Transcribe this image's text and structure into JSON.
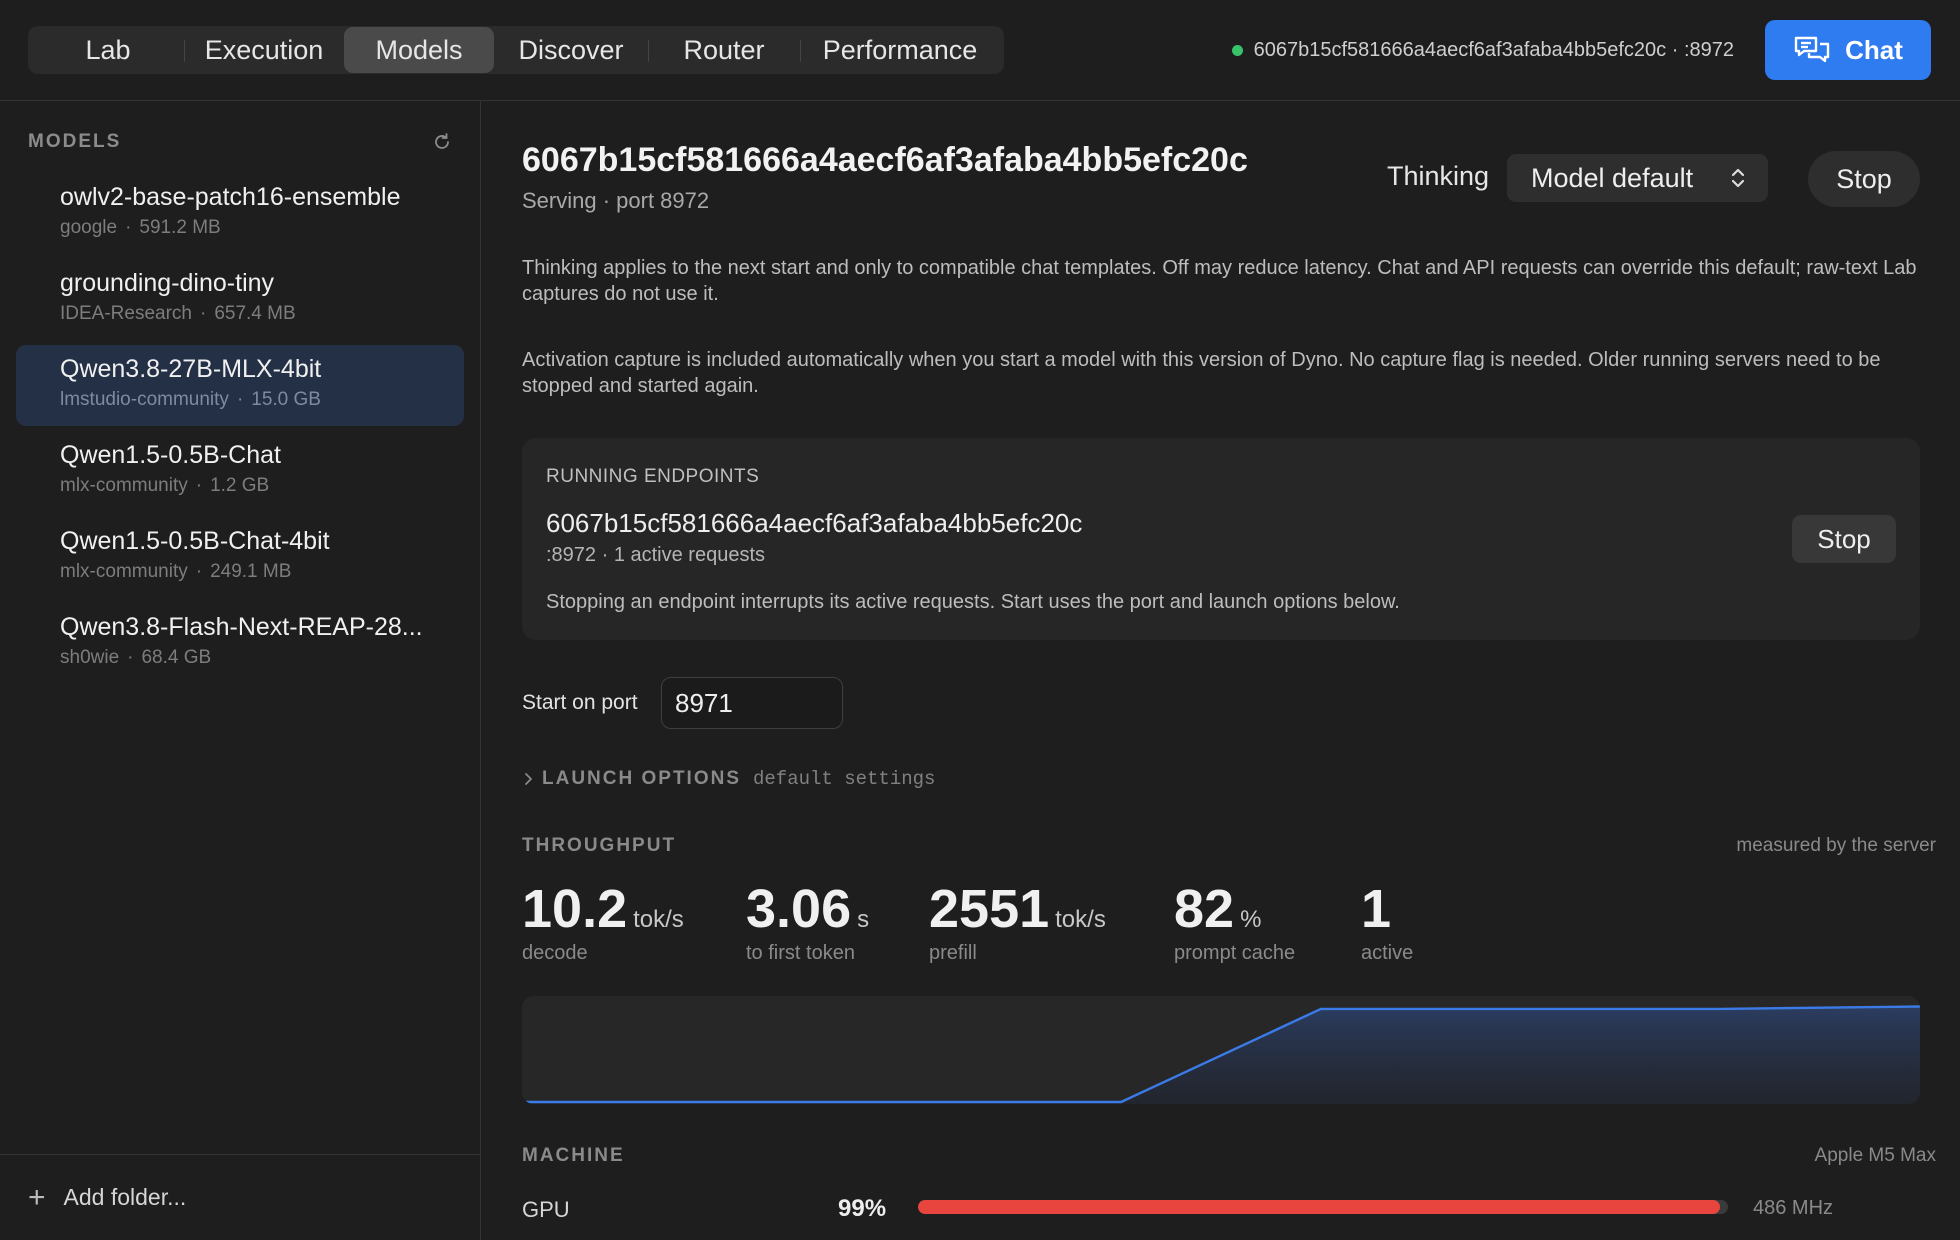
{
  "tabs": [
    {
      "label": "Lab",
      "active": false
    },
    {
      "label": "Execution",
      "active": false
    },
    {
      "label": "Models",
      "active": true
    },
    {
      "label": "Discover",
      "active": false
    },
    {
      "label": "Router",
      "active": false
    },
    {
      "label": "Performance",
      "active": false
    }
  ],
  "header": {
    "endpoint_status": "6067b15cf581666a4aecf6af3afaba4bb5efc20c · :8972",
    "chat_label": "Chat"
  },
  "sidebar": {
    "title": "MODELS",
    "models": [
      {
        "name": "owlv2-base-patch16-ensemble",
        "org": "google",
        "size": "591.2 MB",
        "selected": false
      },
      {
        "name": "grounding-dino-tiny",
        "org": "IDEA-Research",
        "size": "657.4 MB",
        "selected": false
      },
      {
        "name": "Qwen3.8-27B-MLX-4bit",
        "org": "lmstudio-community",
        "size": "15.0 GB",
        "selected": true
      },
      {
        "name": "Qwen1.5-0.5B-Chat",
        "org": "mlx-community",
        "size": "1.2 GB",
        "selected": false
      },
      {
        "name": "Qwen1.5-0.5B-Chat-4bit",
        "org": "mlx-community",
        "size": "249.1 MB",
        "selected": false
      },
      {
        "name": "Qwen3.8-Flash-Next-REAP-28...",
        "org": "sh0wie",
        "size": "68.4 GB",
        "selected": false
      }
    ],
    "separator": "·",
    "add_folder": "Add folder..."
  },
  "main": {
    "title": "6067b15cf581666a4aecf6af3afaba4bb5efc20c",
    "subtitle": "Serving · port 8972",
    "thinking_label": "Thinking",
    "thinking_value": "Model default",
    "stop_label": "Stop",
    "note_thinking": "Thinking applies to the next start and only to compatible chat templates. Off may reduce latency. Chat and API requests can override this default; raw-text Lab captures do not use it.",
    "note_activation": "Activation capture is included automatically when you start a model with this version of Dyno. No capture flag is needed. Older running servers need to be stopped and started again.",
    "running": {
      "title": "RUNNING ENDPOINTS",
      "name": "6067b15cf581666a4aecf6af3afaba4bb5efc20c",
      "meta": ":8972 · 1 active requests",
      "stop_label": "Stop",
      "note": "Stopping an endpoint interrupts its active requests. Start uses the port and launch options below."
    },
    "port_label": "Start on port",
    "port_value": "8971",
    "launch_title": "LAUNCH OPTIONS",
    "launch_desc": "default settings",
    "throughput": {
      "title": "THROUGHPUT",
      "note": "measured by the server",
      "stats": [
        {
          "value": "10.2",
          "unit": "tok/s",
          "label": "decode"
        },
        {
          "value": "3.06",
          "unit": "s",
          "label": "to first token"
        },
        {
          "value": "2551",
          "unit": "tok/s",
          "label": "prefill"
        },
        {
          "value": "82",
          "unit": "%",
          "label": "prompt cache"
        },
        {
          "value": "1",
          "unit": "",
          "label": "active"
        }
      ]
    },
    "machine": {
      "title": "MACHINE",
      "chip": "Apple M5 Max",
      "gpu_label": "GPU",
      "gpu_percent": "99%",
      "gpu_fraction": 0.99,
      "gpu_freq": "486 MHz"
    }
  },
  "colors": {
    "accent": "#2f7bf0",
    "status_ok": "#38c26a",
    "gpu_bar": "#e8453f",
    "selected_row": "#243046"
  },
  "chart_data": {
    "type": "area",
    "x": [
      0,
      1,
      2,
      3,
      4,
      5,
      6,
      7
    ],
    "series": [
      {
        "values": [
          0,
          0,
          0,
          0,
          0.38,
          0.38,
          0.38,
          0.39
        ]
      }
    ],
    "ylim": [
      0,
      0.4
    ],
    "grid": false,
    "color": "#3b7be8"
  }
}
